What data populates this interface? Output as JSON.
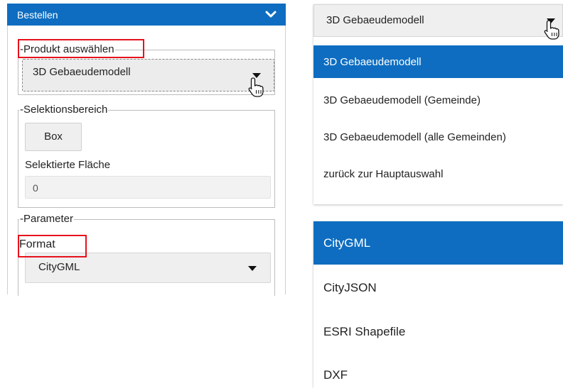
{
  "panel": {
    "header_title": "Bestellen",
    "product_group": {
      "legend": "-Produkt auswählen",
      "selected": "3D Gebaeudemodell"
    },
    "selection_group": {
      "legend": "-Selektionsbereich",
      "box_button": "Box",
      "area_label": "Selektierte Fläche",
      "area_value": "0"
    },
    "parameter_group": {
      "legend": "-Parameter",
      "format_label": "Format",
      "format_selected": "CityGML"
    }
  },
  "product_dropdown": {
    "selected": "3D Gebaeudemodell",
    "options": [
      "3D Gebaeudemodell",
      "3D Gebaeudemodell (Gemeinde)",
      "3D Gebaeudemodell (alle Gemeinden)",
      "zurück zur Hauptauswahl"
    ],
    "active_index": 0
  },
  "format_dropdown": {
    "options": [
      "CityGML",
      "CityJSON",
      "ESRI Shapefile",
      "DXF"
    ],
    "active_index": 0
  },
  "colors": {
    "accent": "#0e6dc0",
    "highlight": "#e6121c"
  },
  "icons": {
    "header_toggle": "chevron-down-icon",
    "cursor": "hand-pointer-icon",
    "dropdown_arrow": "caret-down-icon"
  }
}
